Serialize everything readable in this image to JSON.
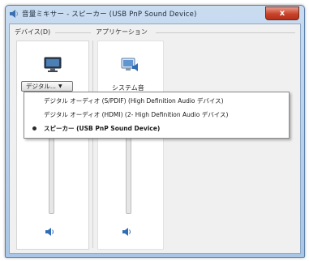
{
  "window": {
    "title": "音量ミキサー - スピーカー (USB PnP Sound Device)",
    "close_label": "x"
  },
  "groups": {
    "device_label": "デバイス(D)",
    "application_label": "アプリケーション"
  },
  "device_column": {
    "dropdown_value": "デジタル...",
    "icon": "monitor-icon"
  },
  "application_column": {
    "label": "システム音",
    "icon": "system-sounds-icon"
  },
  "dropdown_menu": {
    "items": [
      {
        "label": "デジタル オーディオ (S/PDIF) (High Definition Audio デバイス)",
        "selected": false
      },
      {
        "label": "デジタル オーディオ (HDMI) (2- High Definition Audio デバイス)",
        "selected": false
      },
      {
        "label": "スピーカー (USB PnP Sound Device)",
        "selected": true
      }
    ]
  },
  "colors": {
    "title_bar": "#a9c6e6",
    "close_button": "#c9432a",
    "speaker_icon": "#2f6db5"
  }
}
